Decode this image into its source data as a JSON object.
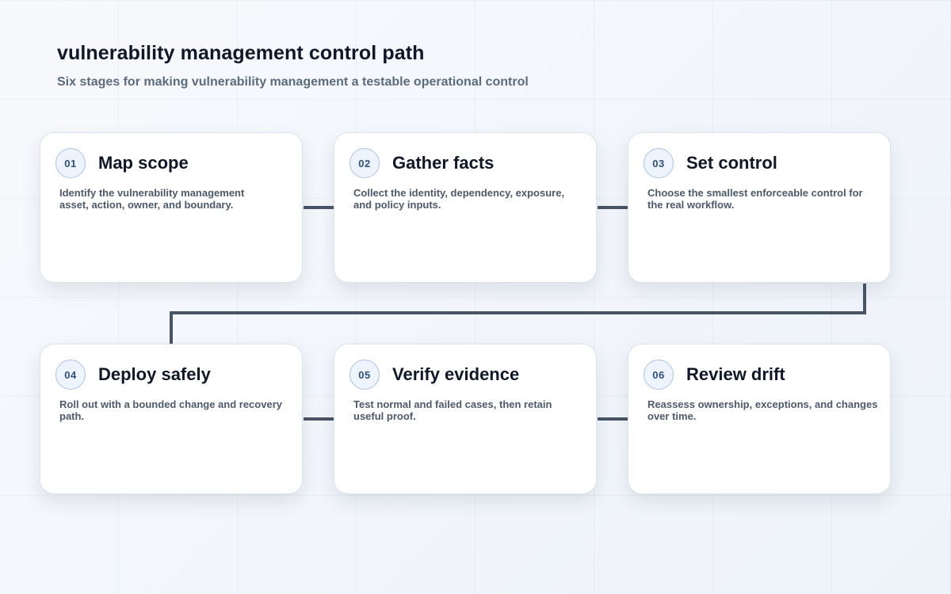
{
  "header": {
    "title": "vulnerability management control path",
    "subtitle": "Six stages for making vulnerability management a testable operational control"
  },
  "stages": [
    {
      "number": "01",
      "title": "Map scope",
      "description": "Identify the vulnerability management asset, action, owner, and boundary."
    },
    {
      "number": "02",
      "title": "Gather facts",
      "description": "Collect the identity, dependency, exposure, and policy inputs."
    },
    {
      "number": "03",
      "title": "Set control",
      "description": "Choose the smallest enforceable control for the real workflow."
    },
    {
      "number": "04",
      "title": "Deploy safely",
      "description": "Roll out with a bounded change and recovery path."
    },
    {
      "number": "05",
      "title": "Verify evidence",
      "description": "Test normal and failed cases, then retain useful proof."
    },
    {
      "number": "06",
      "title": "Review drift",
      "description": "Reassess ownership, exceptions, and changes over time."
    }
  ],
  "colors": {
    "connector": "#475569",
    "badge_border": "#a9c3ea",
    "badge_fill": "#eef4fd",
    "badge_text": "#2c4f86"
  }
}
